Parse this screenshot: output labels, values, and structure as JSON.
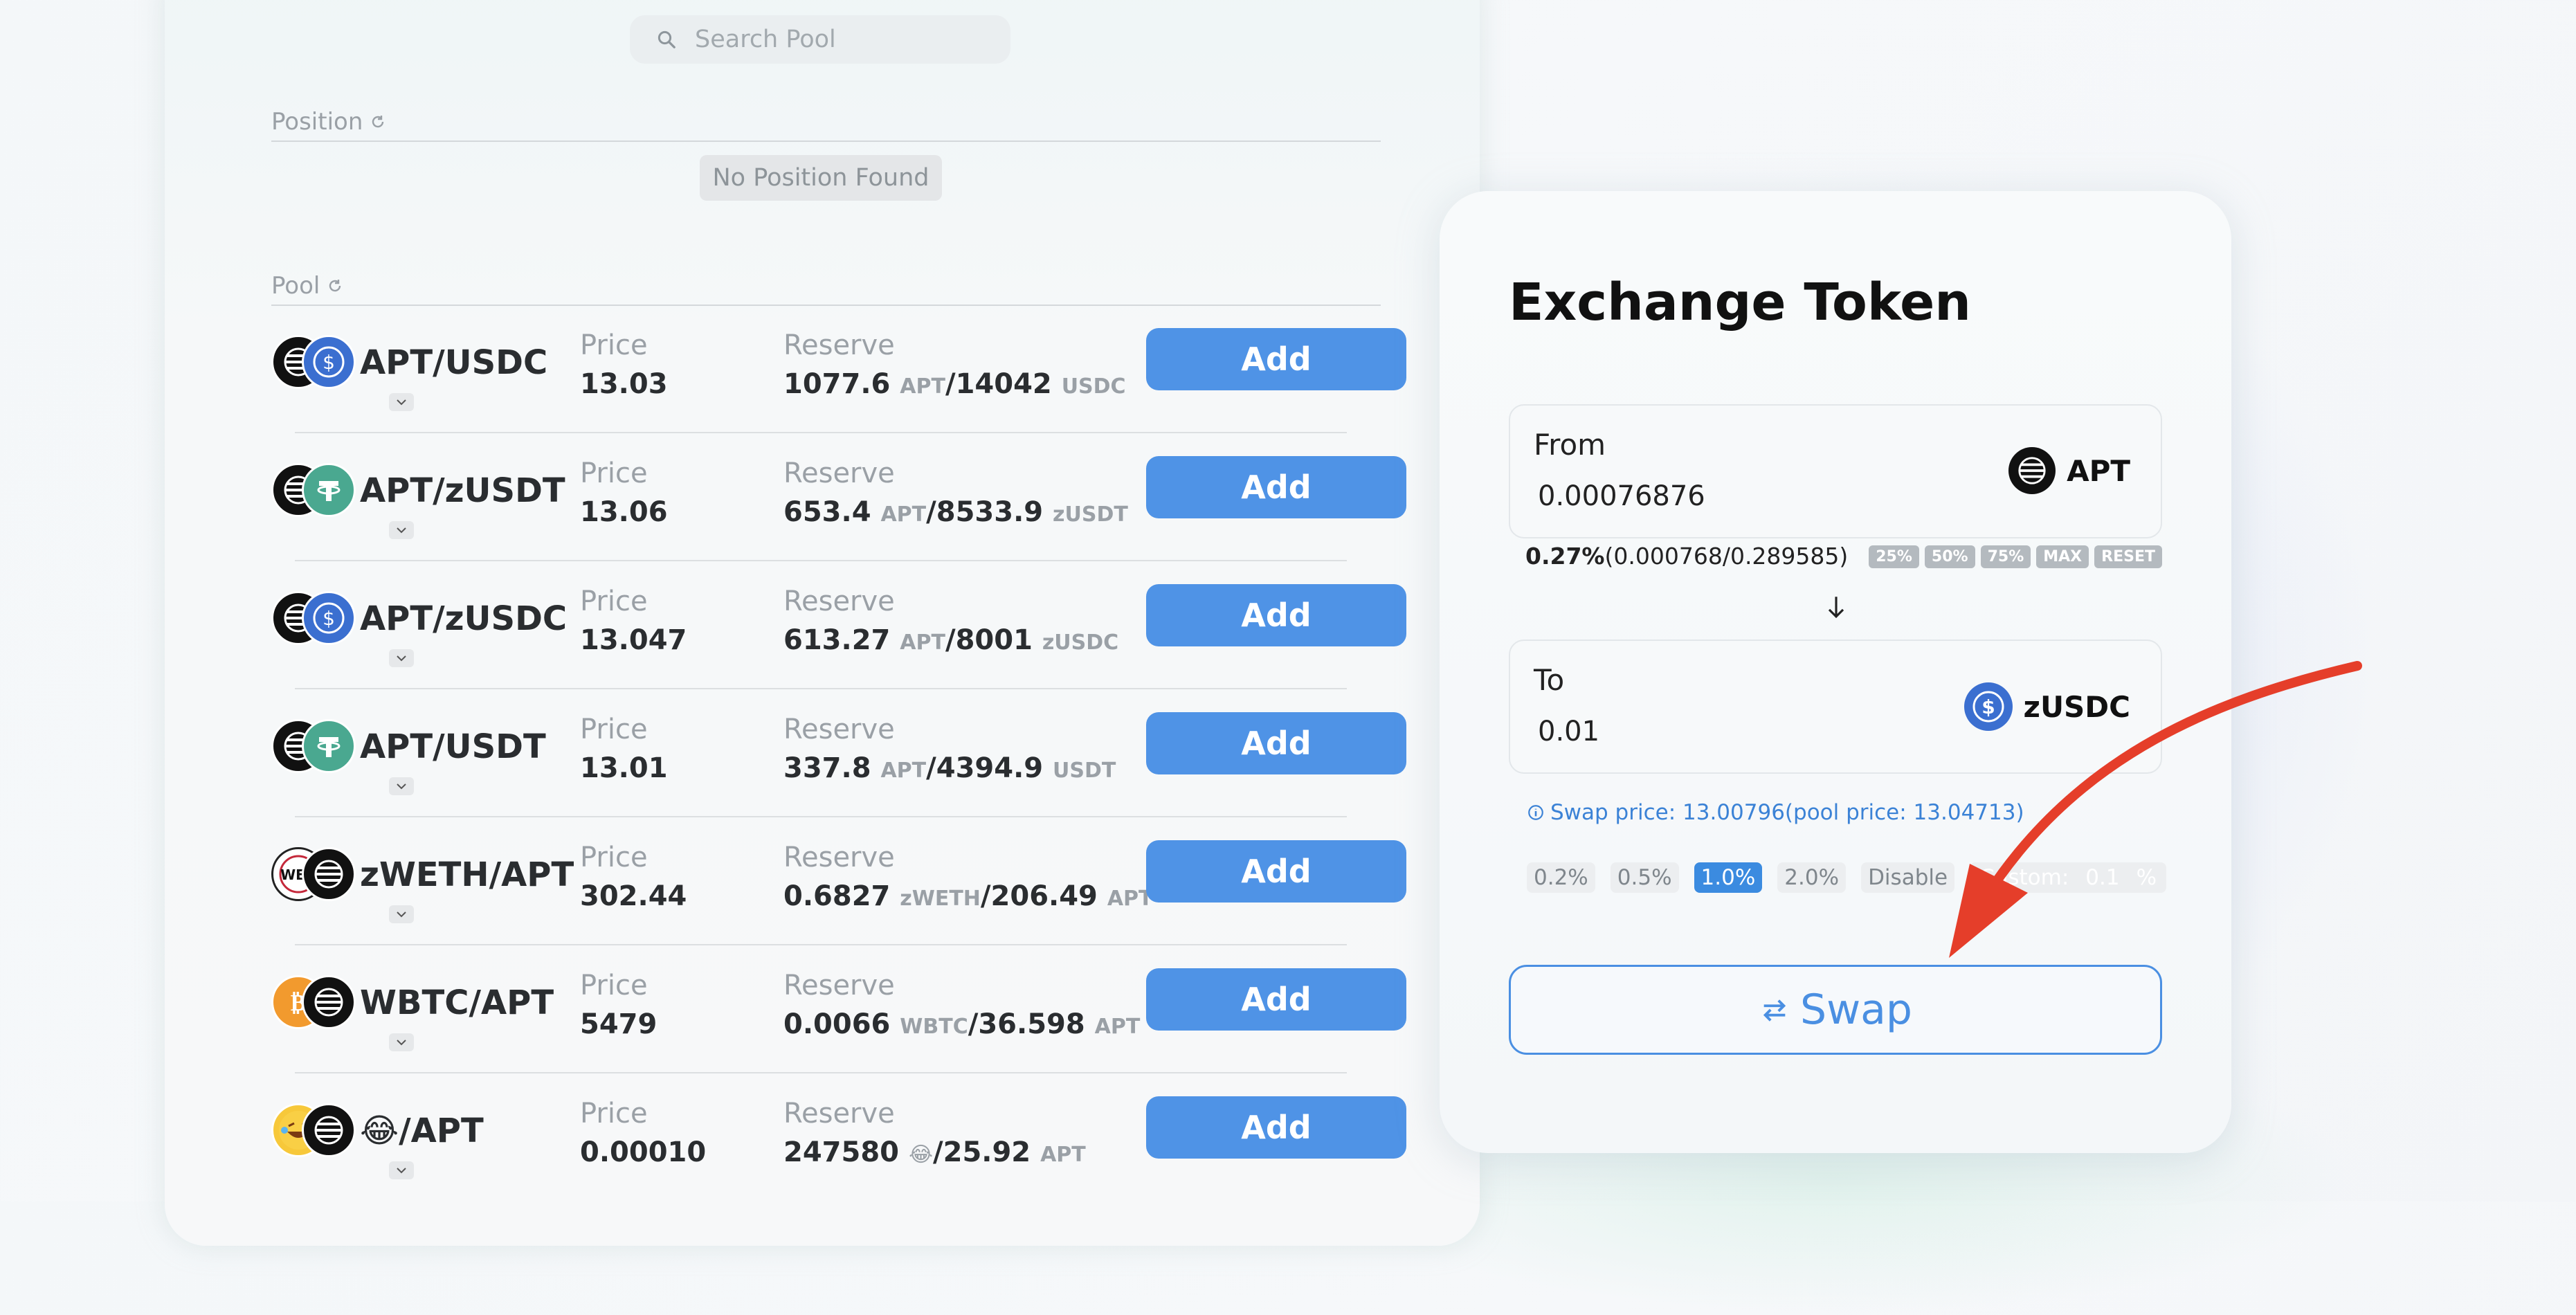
{
  "search": {
    "placeholder": "Search Pool"
  },
  "position": {
    "title": "Position",
    "empty_text": "No Position Found"
  },
  "pool": {
    "title": "Pool",
    "price_label": "Price",
    "reserve_label": "Reserve",
    "add_label": "Add",
    "rows": [
      {
        "name": "APT/USDC",
        "price": "13.03",
        "reserve_a": "1077.6",
        "unit_a": "APT",
        "reserve_b": "14042",
        "unit_b": "USDC"
      },
      {
        "name": "APT/zUSDT",
        "price": "13.06",
        "reserve_a": "653.4",
        "unit_a": "APT",
        "reserve_b": "8533.9",
        "unit_b": "zUSDT"
      },
      {
        "name": "APT/zUSDC",
        "price": "13.047",
        "reserve_a": "613.27",
        "unit_a": "APT",
        "reserve_b": "8001",
        "unit_b": "zUSDC"
      },
      {
        "name": "APT/USDT",
        "price": "13.01",
        "reserve_a": "337.8",
        "unit_a": "APT",
        "reserve_b": "4394.9",
        "unit_b": "USDT"
      },
      {
        "name": "zWETH/APT",
        "price": "302.44",
        "reserve_a": "0.6827",
        "unit_a": "zWETH",
        "reserve_b": "206.49",
        "unit_b": "APT"
      },
      {
        "name": "WBTC/APT",
        "price": "5479",
        "reserve_a": "0.0066",
        "unit_a": "WBTC",
        "reserve_b": "36.598",
        "unit_b": "APT"
      },
      {
        "name": "😂/APT",
        "price": "0.00010",
        "reserve_a": "247580",
        "unit_a": "😂",
        "reserve_b": "25.92",
        "unit_b": "APT"
      }
    ]
  },
  "exchange": {
    "title": "Exchange Token",
    "from": {
      "label": "From",
      "amount": "0.00076876",
      "token": "APT"
    },
    "percent_strong": "0.27%",
    "percent_detail": "(0.000768/0.289585)",
    "chips": [
      "25%",
      "50%",
      "75%",
      "MAX",
      "RESET"
    ],
    "to": {
      "label": "To",
      "amount": "0.01",
      "token": "zUSDC"
    },
    "swap_price_text": "Swap price: 13.00796(pool price: 13.04713)",
    "slippage": [
      "0.2%",
      "0.5%",
      "1.0%",
      "2.0%",
      "Disable"
    ],
    "slippage_active": "1.0%",
    "custom_label": "Custom:",
    "custom_value": "0.1",
    "custom_unit": "%",
    "swap_label": "Swap"
  },
  "colors": {
    "accent": "#4f93e6",
    "arrow": "#e53e2a"
  }
}
